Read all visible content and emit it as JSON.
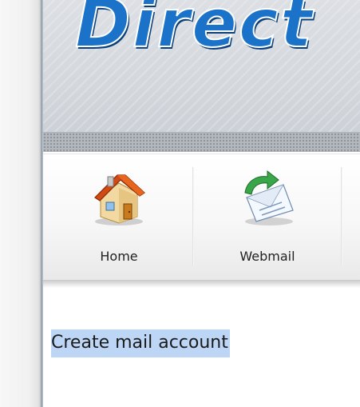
{
  "header": {
    "logo_text": "Direct"
  },
  "nav": {
    "items": [
      {
        "label": "Home",
        "icon": "home-icon"
      },
      {
        "label": "Webmail",
        "icon": "webmail-icon"
      }
    ]
  },
  "content": {
    "link_label": "Create mail account"
  },
  "colors": {
    "logo_blue": "#1a73c9",
    "selection_highlight": "#bdd6f5",
    "home_roof": "#d04a14",
    "webmail_arrow": "#3aa64a"
  }
}
